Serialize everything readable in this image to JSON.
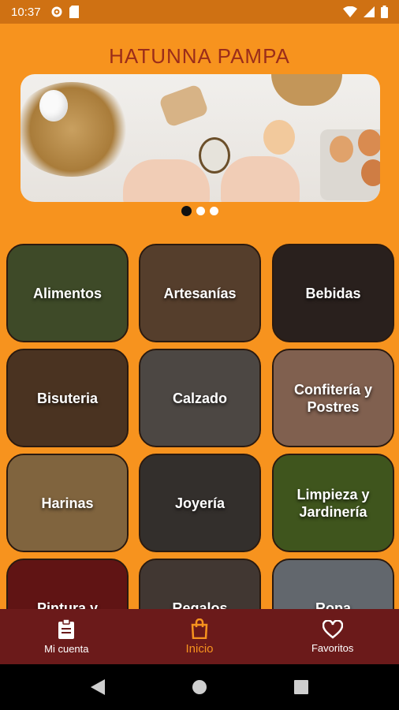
{
  "status_bar": {
    "time": "10:37"
  },
  "app": {
    "title": "HATUNNA PAMPA"
  },
  "carousel": {
    "page_count": 3,
    "active_index": 0
  },
  "categories": [
    {
      "label": "Alimentos",
      "bg": "#5a6a3a"
    },
    {
      "label": "Artesanías",
      "bg": "#7a5a40"
    },
    {
      "label": "Bebidas",
      "bg": "#3b2f2a"
    },
    {
      "label": "Bisuteria",
      "bg": "#6a4a30"
    },
    {
      "label": "Calzado",
      "bg": "#6e6660"
    },
    {
      "label": "Confitería y Postres",
      "bg": "#b88a72"
    },
    {
      "label": "Harinas",
      "bg": "#b8905a"
    },
    {
      "label": "Joyería",
      "bg": "#4a4440"
    },
    {
      "label": "Limpieza y Jardinería",
      "bg": "#5b7a2a"
    },
    {
      "label": "Pintura y",
      "bg": "#8a1e1e"
    },
    {
      "label": "Regalos",
      "bg": "#5e5048"
    },
    {
      "label": "Ropa",
      "bg": "#8d949c"
    }
  ],
  "nav": {
    "items": [
      {
        "label": "Mi cuenta",
        "icon": "clipboard-icon"
      },
      {
        "label": "Inicio",
        "icon": "shopping-bag-icon"
      },
      {
        "label": "Favoritos",
        "icon": "heart-icon"
      }
    ],
    "active": "Inicio",
    "active_color": "#F7931E"
  }
}
